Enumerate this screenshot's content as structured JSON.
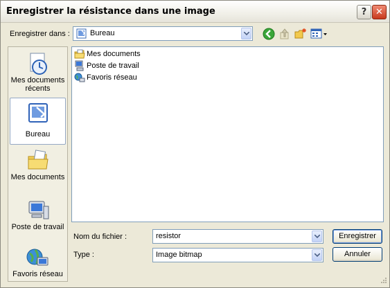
{
  "window": {
    "title": "Enregistrer la résistance dans une image",
    "help_glyph": "?",
    "close_glyph": "✕"
  },
  "location": {
    "label": "Enregistrer dans :",
    "value": "Bureau",
    "icon": "desktop-icon"
  },
  "toolbar": {
    "icons": [
      "back-icon",
      "up-folder-icon",
      "new-folder-icon",
      "view-menu-icon"
    ]
  },
  "places": [
    {
      "label": "Mes documents récents",
      "icon": "recent-documents-icon",
      "selected": false
    },
    {
      "label": "Bureau",
      "icon": "desktop-icon",
      "selected": true
    },
    {
      "label": "Mes documents",
      "icon": "my-documents-icon",
      "selected": false
    },
    {
      "label": "Poste de travail",
      "icon": "my-computer-icon",
      "selected": false
    },
    {
      "label": "Favoris réseau",
      "icon": "network-places-icon",
      "selected": false
    }
  ],
  "files": [
    {
      "name": "Mes documents",
      "icon": "documents-folder-icon"
    },
    {
      "name": "Poste de travail",
      "icon": "computer-icon"
    },
    {
      "name": "Favoris réseau",
      "icon": "network-icon"
    }
  ],
  "filename": {
    "label": "Nom du fichier :",
    "value": "resistor"
  },
  "filetype": {
    "label": "Type :",
    "value": "Image bitmap"
  },
  "buttons": {
    "save": "Enregistrer",
    "cancel": "Annuler"
  },
  "colors": {
    "accent": "#316ac5",
    "dialog_bg": "#ece9d8",
    "field_border": "#7f9db9"
  }
}
